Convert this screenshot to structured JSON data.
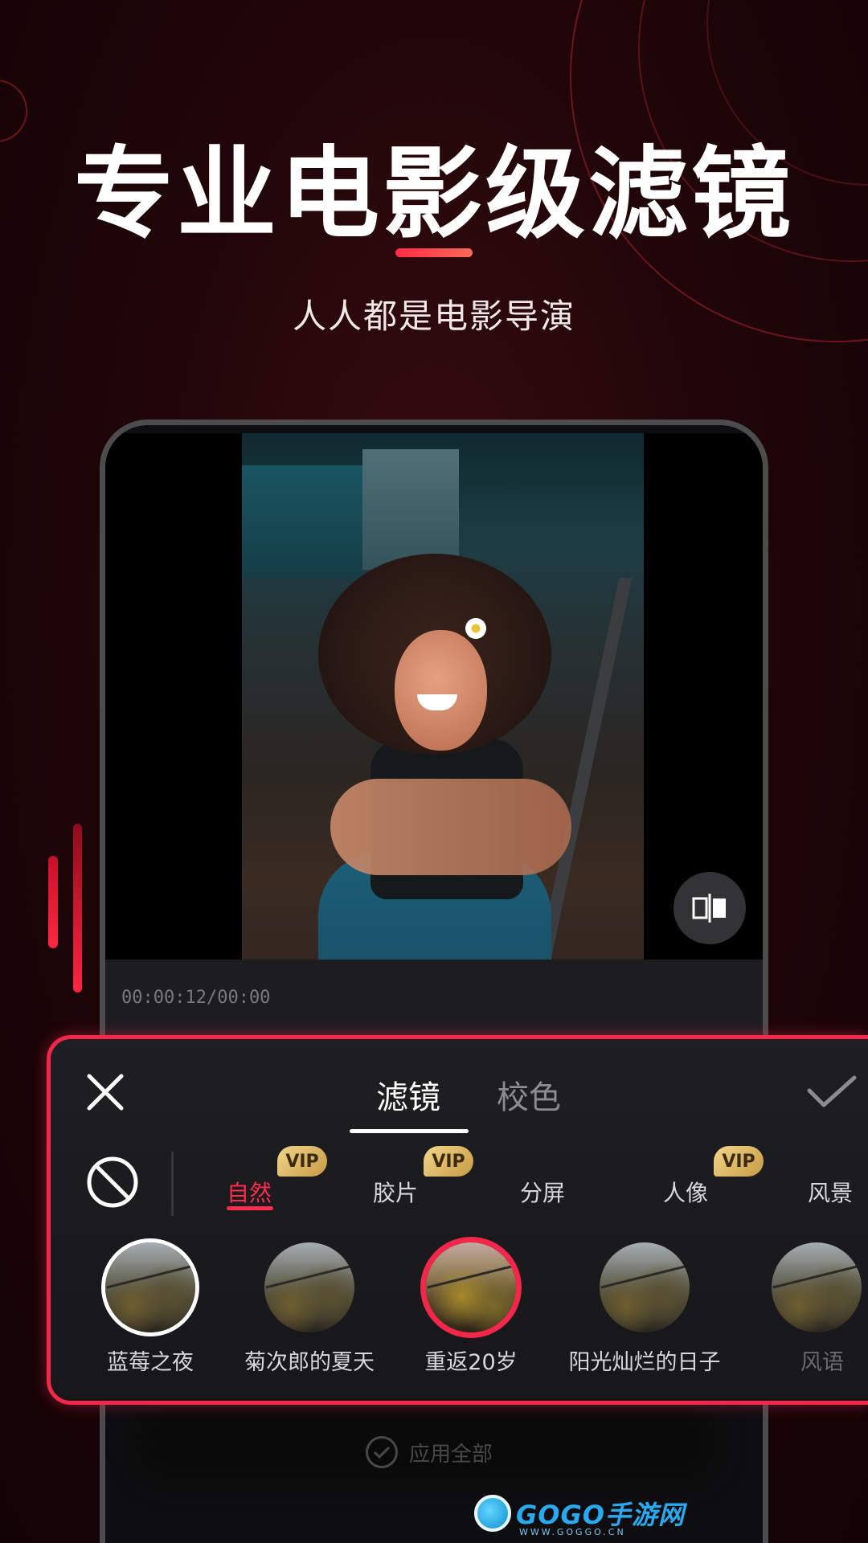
{
  "headline": {
    "title": "专业电影级滤镜",
    "subtitle": "人人都是电影导演"
  },
  "video": {
    "timecode": "00:00:12/00:00"
  },
  "filter_panel": {
    "tabs": [
      {
        "label": "滤镜",
        "active": true
      },
      {
        "label": "校色",
        "active": false
      }
    ],
    "categories": [
      {
        "label": "自然",
        "vip": true,
        "active": true
      },
      {
        "label": "胶片",
        "vip": true,
        "active": false
      },
      {
        "label": "分屏",
        "vip": false,
        "active": false
      },
      {
        "label": "人像",
        "vip": true,
        "active": false
      },
      {
        "label": "风景",
        "vip": false,
        "active": false
      }
    ],
    "vip_label": "VIP",
    "filters": [
      {
        "label": "蓝莓之夜",
        "state": "selected"
      },
      {
        "label": "菊次郎的夏天",
        "state": "normal"
      },
      {
        "label": "重返20岁",
        "state": "highlighted"
      },
      {
        "label": "阳光灿烂的日子",
        "state": "normal"
      },
      {
        "label": "风语",
        "state": "faded"
      }
    ]
  },
  "apply_all": {
    "label": "应用全部"
  },
  "watermark": {
    "brand": "GOGO手游网",
    "url": "WWW.GOGGO.CN"
  },
  "colors": {
    "accent": "#f2274a",
    "background": "#210609",
    "vip_gold": "#d9b160"
  }
}
